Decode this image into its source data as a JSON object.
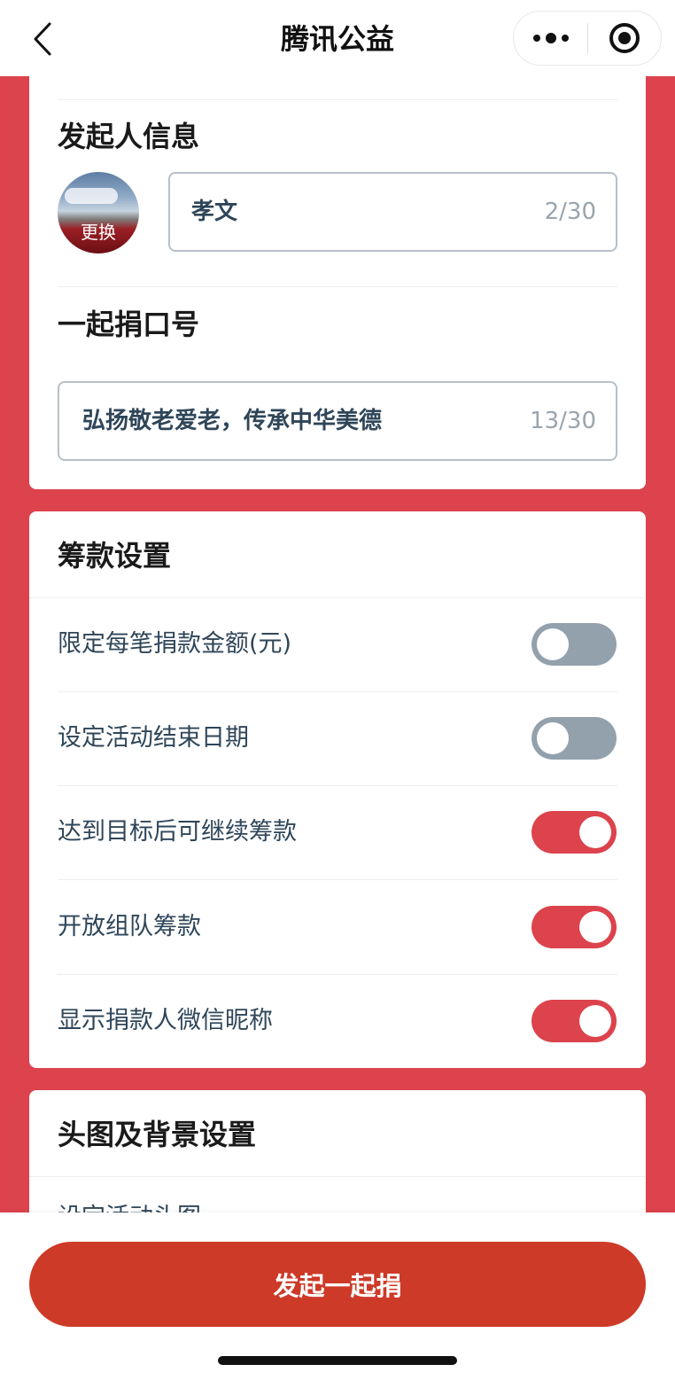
{
  "nav": {
    "title": "腾讯公益",
    "back_icon": "chevron-left-icon",
    "menu_icon": "more-dots-icon",
    "close_icon": "target-icon"
  },
  "initiator": {
    "title": "发起人信息",
    "avatar_label": "更换",
    "name_value": "孝文",
    "name_count": "2/30"
  },
  "slogan": {
    "title": "一起捐口号",
    "value": "弘扬敬老爱老，传承中华美德",
    "count": "13/30"
  },
  "fundraising": {
    "title": "筹款设置",
    "items": [
      {
        "label": "限定每笔捐款金额(元)",
        "enabled": false
      },
      {
        "label": "设定活动结束日期",
        "enabled": false
      },
      {
        "label": "达到目标后可继续筹款",
        "enabled": true
      },
      {
        "label": "开放组队筹款",
        "enabled": true
      },
      {
        "label": "显示捐款人微信昵称",
        "enabled": true
      }
    ]
  },
  "header_bg": {
    "title": "头图及背景设置",
    "partial_item": "设定活动头图"
  },
  "bottom": {
    "submit_label": "发起一起捐"
  },
  "colors": {
    "brand_red": "#dc434c",
    "button_red": "#cd3a28",
    "toggle_off": "#93a1ad",
    "text_blue_gray": "#2f4659"
  }
}
